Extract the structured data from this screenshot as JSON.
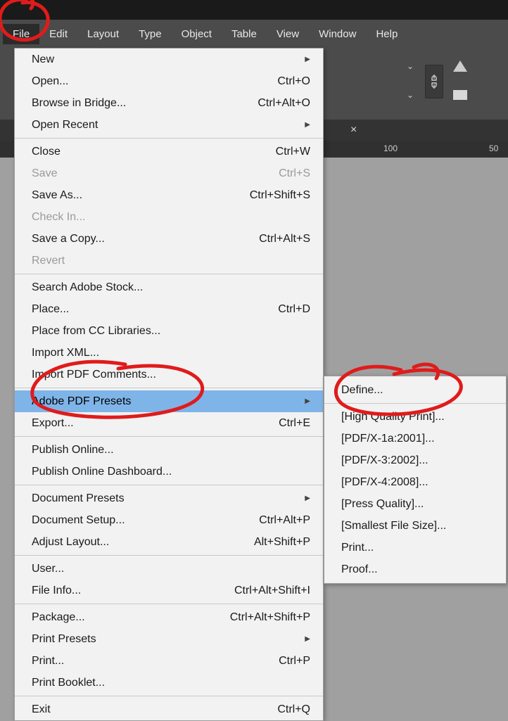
{
  "menubar": {
    "items": [
      "File",
      "Edit",
      "Layout",
      "Type",
      "Object",
      "Table",
      "View",
      "Window",
      "Help"
    ],
    "active_index": 0
  },
  "file_menu": [
    {
      "label": "New",
      "shortcut": "",
      "arrow": true
    },
    {
      "label": "Open...",
      "shortcut": "Ctrl+O"
    },
    {
      "label": "Browse in Bridge...",
      "shortcut": "Ctrl+Alt+O"
    },
    {
      "label": "Open Recent",
      "shortcut": "",
      "arrow": true
    },
    {
      "sep": true
    },
    {
      "label": "Close",
      "shortcut": "Ctrl+W"
    },
    {
      "label": "Save",
      "shortcut": "Ctrl+S",
      "disabled": true
    },
    {
      "label": "Save As...",
      "shortcut": "Ctrl+Shift+S"
    },
    {
      "label": "Check In...",
      "shortcut": "",
      "disabled": true
    },
    {
      "label": "Save a Copy...",
      "shortcut": "Ctrl+Alt+S"
    },
    {
      "label": "Revert",
      "shortcut": "",
      "disabled": true
    },
    {
      "sep": true
    },
    {
      "label": "Search Adobe Stock...",
      "shortcut": ""
    },
    {
      "label": "Place...",
      "shortcut": "Ctrl+D"
    },
    {
      "label": "Place from CC Libraries...",
      "shortcut": ""
    },
    {
      "label": "Import XML...",
      "shortcut": ""
    },
    {
      "label": "Import PDF Comments...",
      "shortcut": ""
    },
    {
      "sep": true
    },
    {
      "label": "Adobe PDF Presets",
      "shortcut": "",
      "arrow": true,
      "highlight": true
    },
    {
      "label": "Export...",
      "shortcut": "Ctrl+E"
    },
    {
      "sep": true
    },
    {
      "label": "Publish Online...",
      "shortcut": ""
    },
    {
      "label": "Publish Online Dashboard...",
      "shortcut": ""
    },
    {
      "sep": true
    },
    {
      "label": "Document Presets",
      "shortcut": "",
      "arrow": true
    },
    {
      "label": "Document Setup...",
      "shortcut": "Ctrl+Alt+P"
    },
    {
      "label": "Adjust Layout...",
      "shortcut": "Alt+Shift+P"
    },
    {
      "sep": true
    },
    {
      "label": "User...",
      "shortcut": ""
    },
    {
      "label": "File Info...",
      "shortcut": "Ctrl+Alt+Shift+I"
    },
    {
      "sep": true
    },
    {
      "label": "Package...",
      "shortcut": "Ctrl+Alt+Shift+P"
    },
    {
      "label": "Print Presets",
      "shortcut": "",
      "arrow": true
    },
    {
      "label": "Print...",
      "shortcut": "Ctrl+P"
    },
    {
      "label": "Print Booklet...",
      "shortcut": ""
    },
    {
      "sep": true
    },
    {
      "label": "Exit",
      "shortcut": "Ctrl+Q"
    }
  ],
  "pdf_presets_submenu": [
    {
      "label": "Define..."
    },
    {
      "sep": true
    },
    {
      "label": "[High Quality Print]..."
    },
    {
      "label": "[PDF/X-1a:2001]..."
    },
    {
      "label": "[PDF/X-3:2002]..."
    },
    {
      "label": "[PDF/X-4:2008]..."
    },
    {
      "label": "[Press Quality]..."
    },
    {
      "label": "[Smallest File Size]..."
    },
    {
      "label": "Print..."
    },
    {
      "label": "Proof..."
    }
  ],
  "ruler": {
    "ticks": [
      "100",
      "50"
    ]
  },
  "options": {
    "chain_tooltip": "link",
    "close_glyph": "×"
  }
}
